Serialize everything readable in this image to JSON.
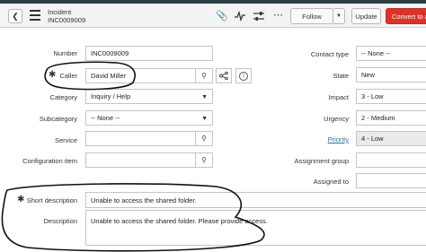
{
  "header": {
    "title": "Incident",
    "number": "INC0009009",
    "follow_label": "Follow",
    "update_label": "Update",
    "convert_label": "Convert to a"
  },
  "form": {
    "number": {
      "label": "Number",
      "value": "INC0009009"
    },
    "caller": {
      "label": "Caller",
      "value": "David Miller"
    },
    "category": {
      "label": "Category",
      "value": "Inquiry / Help"
    },
    "subcategory": {
      "label": "Subcategory",
      "value": "-- None --"
    },
    "service": {
      "label": "Service",
      "value": ""
    },
    "configuration_item": {
      "label": "Configuration item",
      "value": ""
    },
    "contact_type": {
      "label": "Contact type",
      "value": "-- None --"
    },
    "state": {
      "label": "State",
      "value": "New"
    },
    "impact": {
      "label": "Impact",
      "value": "3 - Low"
    },
    "urgency": {
      "label": "Urgency",
      "value": "2 - Medium"
    },
    "priority": {
      "label": "Priority",
      "value": "4 - Low"
    },
    "assignment_group": {
      "label": "Assignment group",
      "value": ""
    },
    "assigned_to": {
      "label": "Assigned to",
      "value": ""
    },
    "short_description": {
      "label": "Short description",
      "value": "Unable to access the shared folder."
    },
    "description": {
      "label": "Description",
      "value": "Unable to access the shared folder. Please provide access."
    }
  },
  "colors": {
    "accent_red": "#d9342b",
    "link": "#1b7a9e",
    "header_bg": "#f3f3f3"
  }
}
